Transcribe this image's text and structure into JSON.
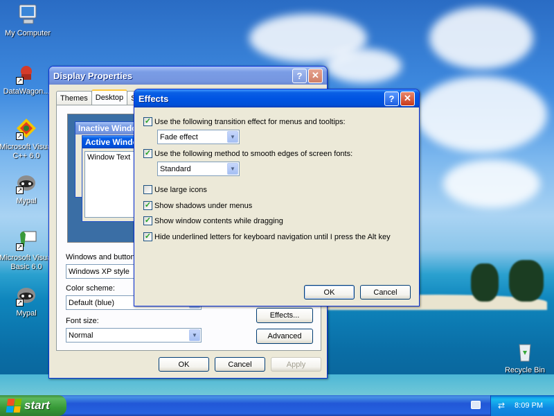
{
  "desktop": {
    "icons": [
      {
        "label": "My Computer"
      },
      {
        "label": "DataWagon..."
      },
      {
        "label": "Microsoft Visual C++ 6.0"
      },
      {
        "label": "Mypal"
      },
      {
        "label": "Microsoft Visual Basic 6.0"
      },
      {
        "label": "Mypal"
      },
      {
        "label": "Recycle Bin"
      }
    ]
  },
  "display_properties": {
    "title": "Display Properties",
    "tabs": [
      "Themes",
      "Desktop",
      "S"
    ],
    "preview": {
      "inactive_title": "Inactive Window",
      "active_title": "Active Window",
      "window_text": "Window Text"
    },
    "windows_buttons_label": "Windows and buttons:",
    "windows_buttons_value": "Windows XP style",
    "color_scheme_label": "Color scheme:",
    "color_scheme_value": "Default (blue)",
    "font_size_label": "Font size:",
    "font_size_value": "Normal",
    "effects_button": "Effects...",
    "advanced_button": "Advanced",
    "ok_button": "OK",
    "cancel_button": "Cancel",
    "apply_button": "Apply"
  },
  "effects": {
    "title": "Effects",
    "options": [
      {
        "label": "Use the following transition effect for menus and tooltips:",
        "checked": true
      },
      {
        "label": "Use the following method to smooth edges of screen fonts:",
        "checked": true
      },
      {
        "label": "Use large icons",
        "checked": false
      },
      {
        "label": "Show shadows under menus",
        "checked": true
      },
      {
        "label": "Show window contents while dragging",
        "checked": true
      },
      {
        "label": "Hide underlined letters for keyboard navigation until I press the Alt key",
        "checked": true
      }
    ],
    "transition_value": "Fade effect",
    "smoothing_value": "Standard",
    "ok_button": "OK",
    "cancel_button": "Cancel"
  },
  "taskbar": {
    "start_label": "start",
    "clock": "8:09 PM"
  },
  "colors": {
    "title_active": "#0054e3",
    "window_face": "#ece9d8",
    "start_green": "#379a37"
  }
}
